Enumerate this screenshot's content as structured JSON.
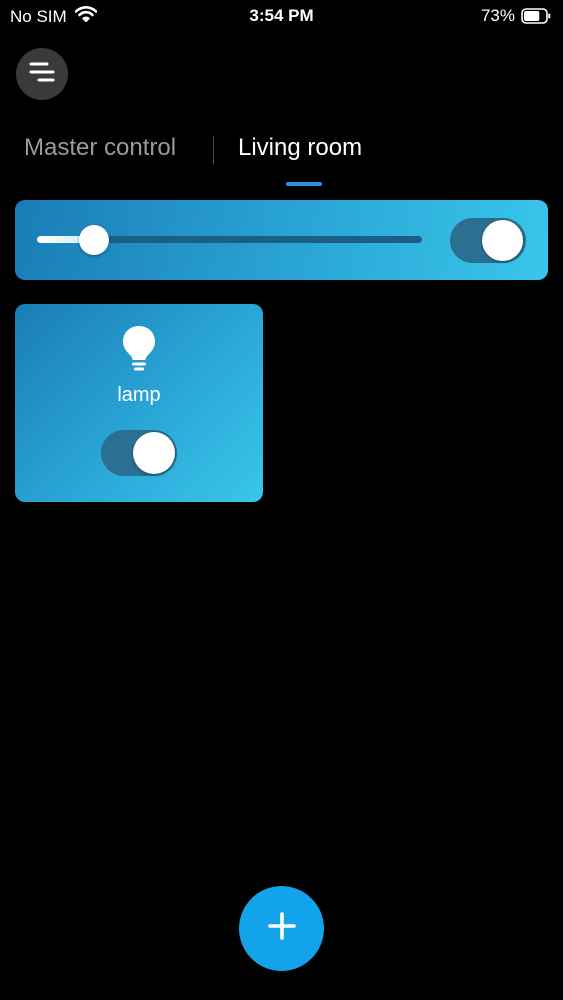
{
  "status_bar": {
    "carrier": "No SIM",
    "time": "3:54 PM",
    "battery_percent": "73%",
    "battery_level": 0.73,
    "icons": [
      "wifi-icon",
      "battery-icon"
    ]
  },
  "header": {
    "menu_icon": "menu-icon"
  },
  "tabs": [
    {
      "label": "Master control",
      "active": false
    },
    {
      "label": "Living room",
      "active": true
    }
  ],
  "master_control": {
    "brightness_level": 0.1,
    "power_on": true
  },
  "devices": [
    {
      "name": "lamp",
      "icon": "lightbulb-icon",
      "on": true
    }
  ],
  "fab": {
    "icon": "plus-icon"
  },
  "colors": {
    "accent": "#2f8fe0",
    "fab": "#13a3ea",
    "card_gradient_start": "#1a7cb6",
    "card_gradient_end": "#39c6ea",
    "toggle_track": "#2b6f92"
  }
}
